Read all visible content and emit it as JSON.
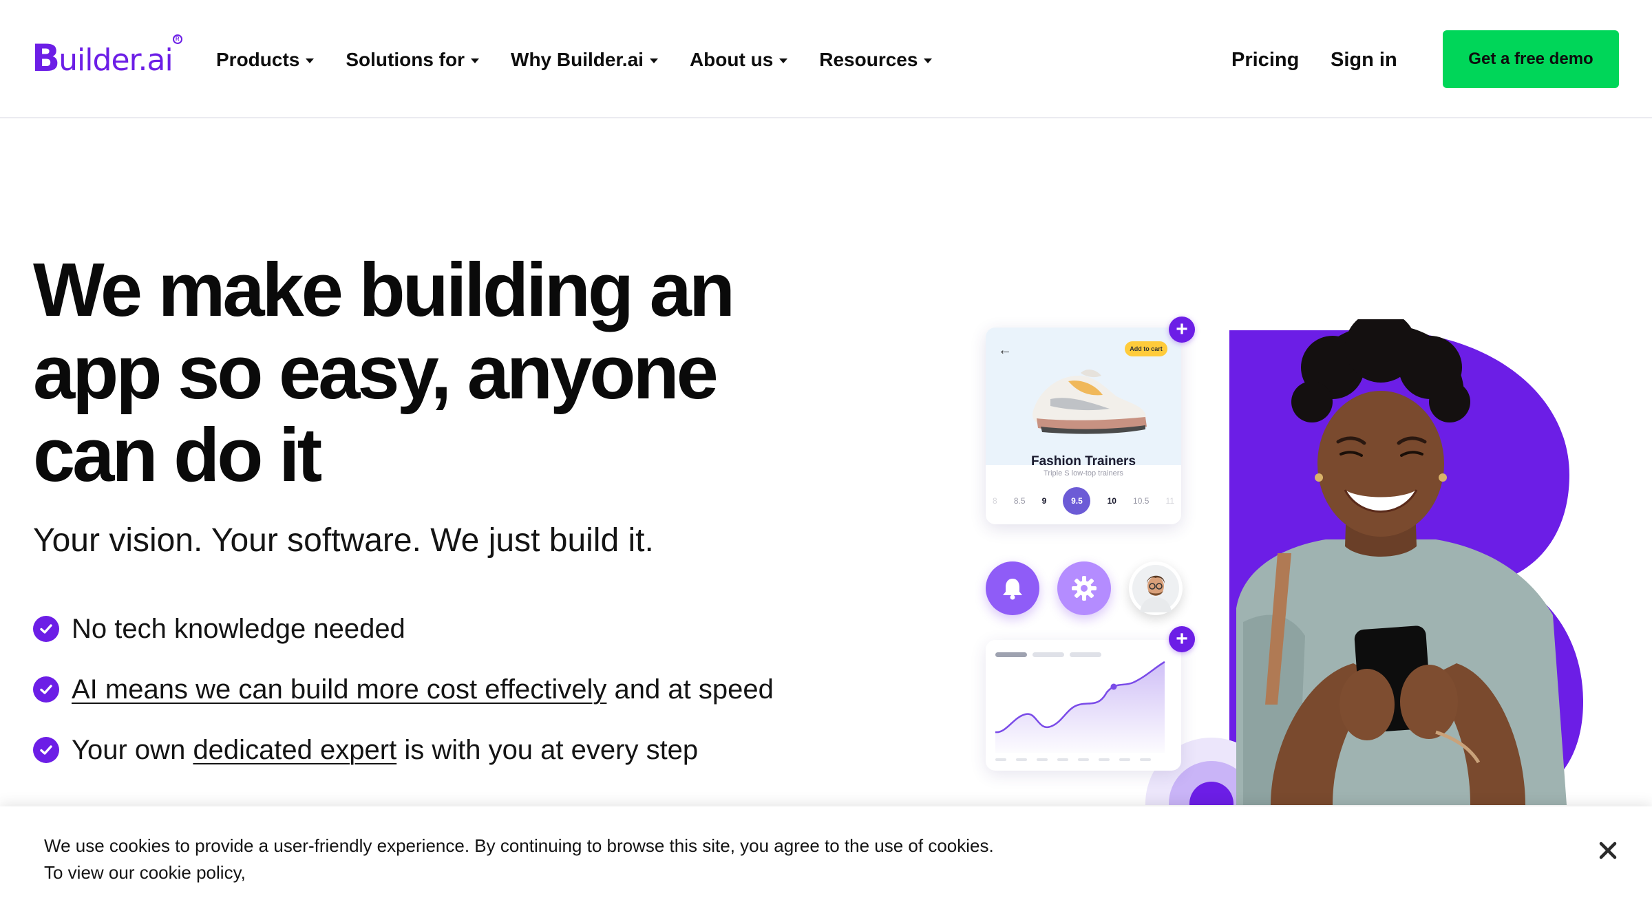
{
  "header": {
    "logo": {
      "letter": "B",
      "text": "uilder.ai",
      "registered": "R"
    },
    "nav": [
      {
        "label": "Products"
      },
      {
        "label": "Solutions for"
      },
      {
        "label": "Why Builder.ai"
      },
      {
        "label": "About us"
      },
      {
        "label": "Resources"
      }
    ],
    "pricing_label": "Pricing",
    "signin_label": "Sign in",
    "demo_label": "Get a free demo"
  },
  "hero": {
    "title_lines": [
      "We make building an",
      "app so easy, anyone",
      "can do it"
    ],
    "subtitle": "Your vision. Your software. We just build it.",
    "bullets": [
      {
        "text": "No tech knowledge needed"
      },
      {
        "link": "AI means we can build more cost effectively",
        "text_after": " and at speed"
      },
      {
        "text_before": "Your own ",
        "link": "dedicated expert",
        "text_after": " is with you at every step"
      }
    ]
  },
  "illustration": {
    "product_card": {
      "button": "Add to cart",
      "title": "Fashion Trainers",
      "subtitle": "Triple S low-top trainers",
      "sizes": [
        "8",
        "8.5",
        "9",
        "9.5",
        "10",
        "10.5",
        "11"
      ],
      "selected_size": "9.5"
    },
    "icons": [
      "bell-icon",
      "gear-icon",
      "avatar",
      "plus-icon",
      "back-arrow-icon"
    ],
    "accent_colors": {
      "brand": "#6c1ee6",
      "cta": "#00d659"
    }
  },
  "cookie_banner": {
    "text": "We use cookies to provide a user-friendly experience. By continuing to browse this site, you agree to the use of cookies. To view our cookie policy,"
  }
}
